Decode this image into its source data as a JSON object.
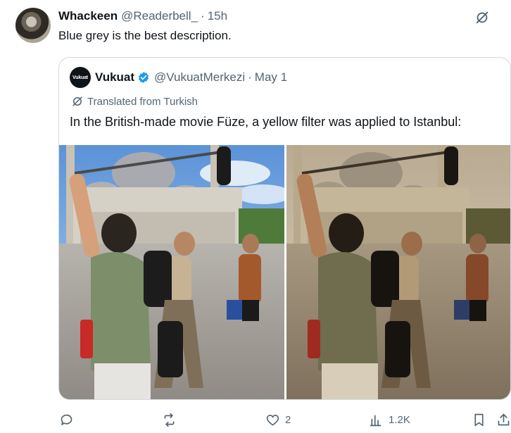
{
  "tweet": {
    "author_name": "Whackeen",
    "author_handle": "@Readerbell_",
    "dot": "·",
    "time": "15h",
    "text": "Blue grey is the best description."
  },
  "quote": {
    "avatar_text": "Vukuat",
    "author_name": "Vukuat",
    "author_handle": "@VukuatMerkezi",
    "dot": "·",
    "date": "May 1",
    "translated_label": "Translated from Turkish",
    "text": "In the British-made movie Füze, a yellow filter was applied to Istanbul:",
    "photos": [
      {
        "description_icon": "photo-original-blue"
      },
      {
        "description_icon": "photo-yellow-filter"
      }
    ]
  },
  "actions": {
    "replies": "",
    "reposts": "",
    "likes": "2",
    "views": "1.2K"
  },
  "colors": {
    "secondary_text": "#536471",
    "border": "#cfd9de",
    "verified": "#1d9bf0"
  }
}
